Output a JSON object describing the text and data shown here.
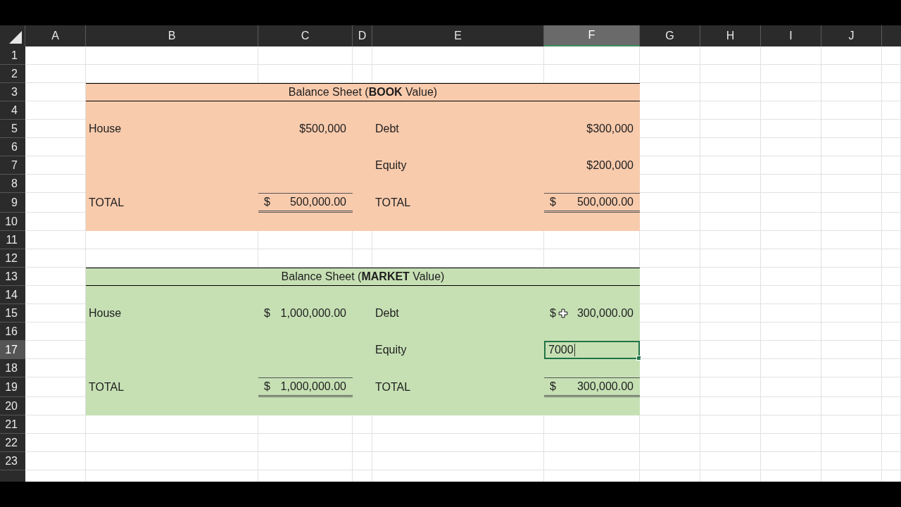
{
  "columns": [
    {
      "label": "A",
      "selected": false
    },
    {
      "label": "B",
      "selected": false
    },
    {
      "label": "C",
      "selected": false
    },
    {
      "label": "D",
      "selected": false
    },
    {
      "label": "E",
      "selected": false
    },
    {
      "label": "F",
      "selected": true
    },
    {
      "label": "G",
      "selected": false
    },
    {
      "label": "H",
      "selected": false
    },
    {
      "label": "I",
      "selected": false
    },
    {
      "label": "J",
      "selected": false
    }
  ],
  "rows": [
    {
      "label": "1",
      "selected": false
    },
    {
      "label": "2",
      "selected": false
    },
    {
      "label": "3",
      "selected": false
    },
    {
      "label": "4",
      "selected": false
    },
    {
      "label": "5",
      "selected": false
    },
    {
      "label": "6",
      "selected": false
    },
    {
      "label": "7",
      "selected": false
    },
    {
      "label": "8",
      "selected": false
    },
    {
      "label": "9",
      "selected": false
    },
    {
      "label": "10",
      "selected": false
    },
    {
      "label": "11",
      "selected": false
    },
    {
      "label": "12",
      "selected": false
    },
    {
      "label": "13",
      "selected": false
    },
    {
      "label": "14",
      "selected": false
    },
    {
      "label": "15",
      "selected": false
    },
    {
      "label": "16",
      "selected": false
    },
    {
      "label": "17",
      "selected": true
    },
    {
      "label": "18",
      "selected": false
    },
    {
      "label": "19",
      "selected": false
    },
    {
      "label": "20",
      "selected": false
    },
    {
      "label": "21",
      "selected": false
    },
    {
      "label": "22",
      "selected": false
    },
    {
      "label": "23",
      "selected": false
    }
  ],
  "sections": [
    {
      "title": "Balance Sheet (**BOOK** Value)",
      "color": "#f8cbad",
      "lines": [
        {
          "kind": "plain",
          "label": "House",
          "amount": {
            "value": "$500,000"
          },
          "label_2": "Debt",
          "amount_2": {
            "value": "$300,000"
          }
        },
        {
          "kind": "plain",
          "label_2": "Equity",
          "amount_2": {
            "value": "$200,000"
          }
        },
        {
          "kind": "total",
          "label": "TOTAL",
          "amount": {
            "symbol": "$",
            "value": "500,000.00"
          },
          "label_2": "TOTAL",
          "amount_2": {
            "symbol": "$",
            "value": "500,000.00"
          }
        }
      ]
    },
    {
      "title": "Balance Sheet (**MARKET** Value)",
      "color": "#c6e0b4",
      "lines": [
        {
          "kind": "plain",
          "label": "House",
          "amount": {
            "symbol": "$",
            "value": "1,000,000.00"
          },
          "label_2": "Debt",
          "amount_2": {
            "symbol": "$",
            "value": "300,000.00",
            "pointer": true
          }
        },
        {
          "kind": "plain",
          "label_2": "Equity",
          "amount_2": {
            "value": "7000",
            "editing": true
          }
        },
        {
          "kind": "total",
          "label": "TOTAL",
          "amount": {
            "symbol": "$",
            "value": "1,000,000.00"
          },
          "label_2": "TOTAL",
          "amount_2": {
            "symbol": "$",
            "value": "300,000.00"
          }
        }
      ]
    }
  ]
}
